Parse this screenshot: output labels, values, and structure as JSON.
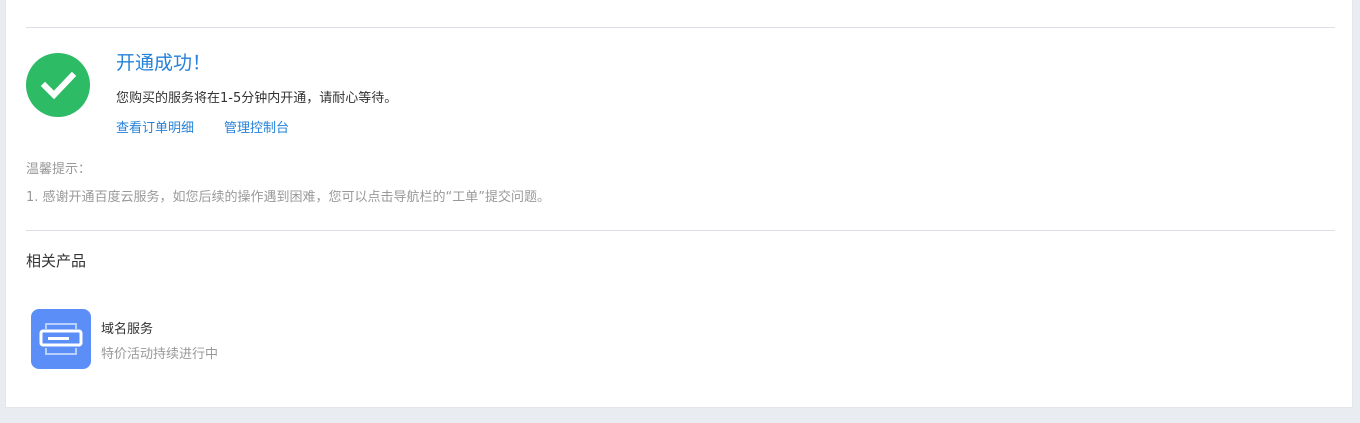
{
  "result": {
    "title": "开通成功！",
    "description": "您购买的服务将在1-5分钟内开通，请耐心等待。",
    "links": {
      "order_detail": "查看订单明细",
      "console": "管理控制台"
    }
  },
  "tips": {
    "heading": "温馨提示：",
    "items": [
      "1. 感谢开通百度云服务，如您后续的操作遇到困难，您可以点击导航栏的“工单”提交问题。"
    ]
  },
  "related": {
    "title": "相关产品",
    "products": [
      {
        "name": "域名服务",
        "description": "特价活动持续进行中",
        "icon": "server-icon"
      }
    ]
  },
  "colors": {
    "success": "#2dbb66",
    "link": "#2682d9",
    "product_icon_bg": "#5b8ef7"
  }
}
